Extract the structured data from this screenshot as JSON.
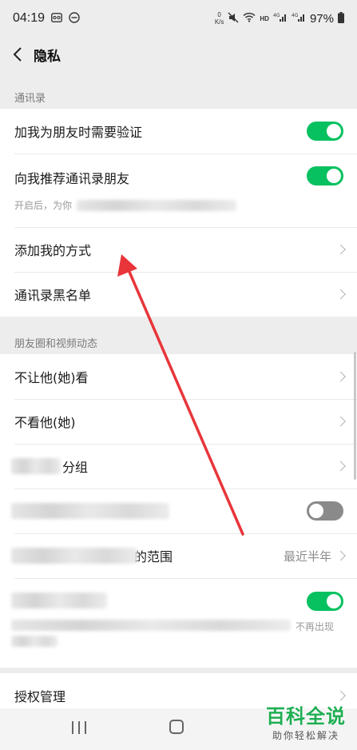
{
  "status_bar": {
    "time": "04:19",
    "battery_percent": "97%",
    "network_speed_top": "0",
    "network_speed_bottom": "K/s",
    "hd_label": "HD",
    "signal_label_1": "4G",
    "signal_label_2": "4G"
  },
  "header": {
    "title": "隐私"
  },
  "sections": {
    "contacts": "通讯录",
    "moments": "朋友圈和视频动态"
  },
  "contacts_group": {
    "verify_label": "加我为朋友时需要验证",
    "verify_on": true,
    "recommend_label": "向我推荐通讯录朋友",
    "recommend_on": true,
    "recommend_sub": "开启后，为你",
    "add_methods_label": "添加我的方式",
    "blacklist_label": "通讯录黑名单"
  },
  "moments_group": {
    "dont_let_see_label": "不让他(她)看",
    "dont_see_label": "不看他(她)",
    "group_label_tail": "分组",
    "partial_toggle_on": false,
    "range_label_tail": "的范围",
    "range_value": "最近半年",
    "last_toggle_on": true,
    "last_sub_tail": "不再出现"
  },
  "authorization": {
    "label": "授权管理"
  },
  "watermark": {
    "title": "百科全说",
    "subtitle": "助你轻松解决"
  },
  "colors": {
    "toggle_on": "#07c160",
    "toggle_off": "#8a8a8a",
    "arrow": "#e8353a"
  }
}
